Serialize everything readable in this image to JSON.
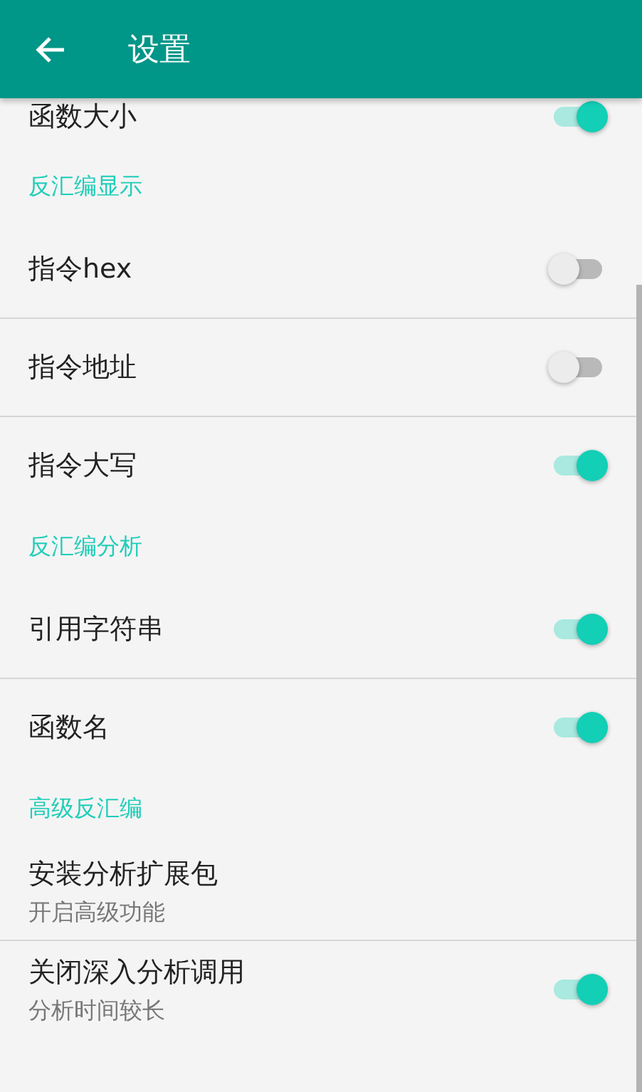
{
  "appbar": {
    "title": "设置"
  },
  "sections": [
    {
      "items": [
        {
          "title": "函数大小",
          "on": true
        }
      ]
    },
    {
      "title": "反汇编显示",
      "items": [
        {
          "title": "指令hex",
          "on": false
        },
        {
          "title": "指令地址",
          "on": false
        },
        {
          "title": "指令大写",
          "on": true
        }
      ]
    },
    {
      "title": "反汇编分析",
      "items": [
        {
          "title": "引用字符串",
          "on": true
        },
        {
          "title": "函数名",
          "on": true
        }
      ]
    },
    {
      "title": "高级反汇编",
      "items": [
        {
          "title": "安装分析扩展包",
          "summary": "开启高级功能"
        },
        {
          "title": "关闭深入分析调用",
          "summary": "分析时间较长",
          "on": true
        }
      ]
    }
  ]
}
